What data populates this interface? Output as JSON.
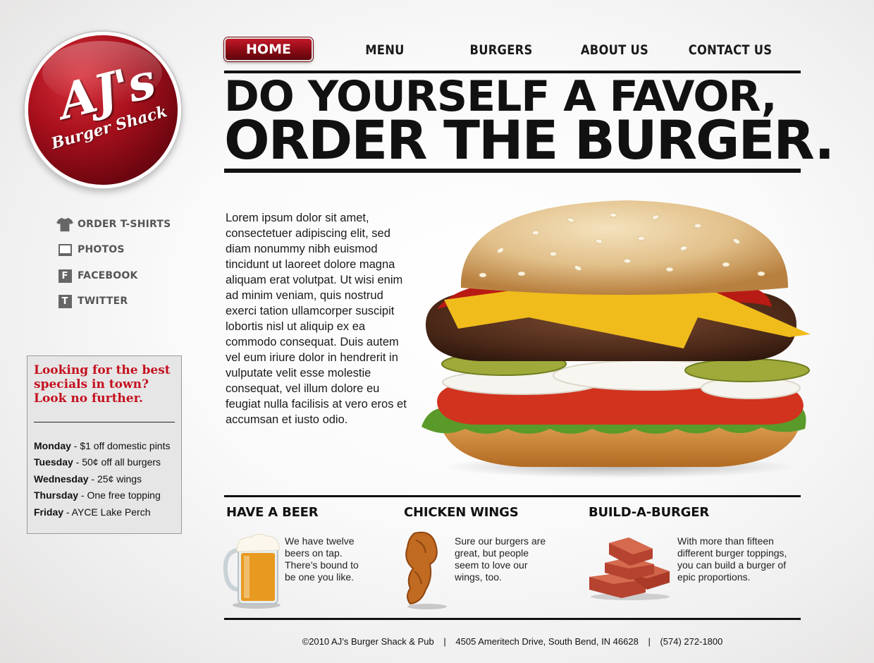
{
  "logo": {
    "main": "AJ's",
    "sub": "Burger Shack"
  },
  "nav": {
    "items": [
      {
        "label": "HOME",
        "active": true
      },
      {
        "label": "MENU",
        "active": false
      },
      {
        "label": "BURGERS",
        "active": false
      },
      {
        "label": "ABOUT US",
        "active": false
      },
      {
        "label": "CONTACT US",
        "active": false
      }
    ]
  },
  "headline": {
    "line1": "DO YOURSELF A FAVOR,",
    "line2": "ORDER THE BURGER."
  },
  "sidebar": {
    "links": [
      {
        "label": "ORDER T-SHIRTS",
        "icon": "tshirt-icon"
      },
      {
        "label": "PHOTOS",
        "icon": "photo-icon"
      },
      {
        "label": "FACEBOOK",
        "icon": "facebook-icon",
        "glyph": "F"
      },
      {
        "label": "TWITTER",
        "icon": "twitter-icon",
        "glyph": "T"
      }
    ],
    "specials": {
      "title": "Looking for the best specials in town? Look no further.",
      "items": [
        {
          "day": "Monday",
          "deal": " - $1 off domestic pints"
        },
        {
          "day": "Tuesday",
          "deal": " - 50¢ off all burgers"
        },
        {
          "day": "Wednesday",
          "deal": " - 25¢ wings"
        },
        {
          "day": "Thursday",
          "deal": " - One free topping"
        },
        {
          "day": "Friday",
          "deal": " - AYCE Lake Perch"
        }
      ]
    }
  },
  "main": {
    "body": "Lorem ipsum dolor sit amet, consectetuer adipiscing elit, sed diam nonummy nibh euismod tincidunt ut laoreet dolore magna aliquam erat volutpat. Ut wisi enim ad minim veniam, quis nostrud exerci tation ullamcorper suscipit lobortis nisl ut aliquip ex ea commodo consequat. Duis autem vel eum iriure dolor in hendrerit in vulputate velit esse molestie consequat, vel illum dolore eu feugiat nulla facilisis at vero eros et accumsan et iusto odio."
  },
  "features": [
    {
      "title": "HAVE A BEER",
      "text": "We have twelve beers on tap. There’s bound to be one you like.",
      "icon": "beer-mug-icon"
    },
    {
      "title": "CHICKEN WINGS",
      "text": "Sure our burgers are great, but people seem to love our wings, too.",
      "icon": "chicken-wing-icon"
    },
    {
      "title": "BUILD-A-BURGER",
      "text": "With more than fifteen different burger toppings, you can build a burger of epic proportions.",
      "icon": "bricks-icon"
    }
  ],
  "footer": {
    "copyright": "©2010 AJ’s Burger Shack & Pub",
    "address": "4505 Ameritech Drive, South Bend, IN 46628",
    "phone": "(574) 272-1800",
    "separator": "|"
  },
  "colors": {
    "brand_red": "#a8101c",
    "specials_red": "#c4101e",
    "rule": "#111111"
  }
}
